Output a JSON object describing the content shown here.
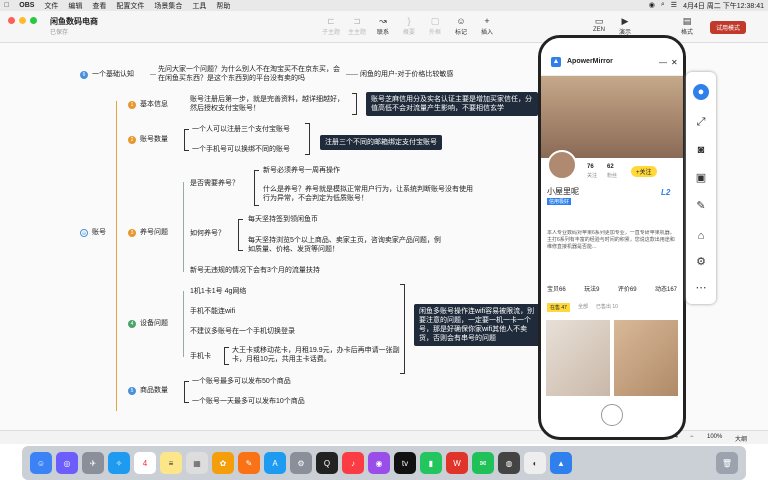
{
  "menubar": {
    "apple": "",
    "app": "OBS",
    "items": [
      "文件",
      "编辑",
      "查看",
      "配置文件",
      "场景集合",
      "工具",
      "帮助"
    ],
    "datetime": "4月4日 周二 下午12:38:41"
  },
  "window": {
    "title": "闲鱼数码电商",
    "subtitle": "已保存"
  },
  "toolbar": {
    "items": [
      {
        "label": "子主题",
        "icon": "⊏"
      },
      {
        "label": "主主题",
        "icon": "⊐"
      },
      {
        "label": "联系",
        "icon": "↝"
      },
      {
        "label": "概要",
        "icon": "}"
      },
      {
        "label": "外框",
        "icon": "▢"
      },
      {
        "label": "标记",
        "icon": "☺"
      },
      {
        "label": "插入",
        "icon": "+"
      }
    ],
    "zen": "ZEN",
    "present": "演示",
    "format": "格式",
    "trial": "试用模式"
  },
  "mindmap": {
    "topic1": {
      "num": "6",
      "label": "一个基础认知",
      "q": "先问大家一个问题？为什么别人不在淘宝买不在京东买，会在闲鱼买东西？是这个东西到的平台没有卖的吗",
      "a": "闲鱼的用户-对于价格比较敏感"
    },
    "root": {
      "label": "账号"
    },
    "b1": {
      "num": "1",
      "label": "基本信息",
      "text": "账号注册后第一步，就是完善资料，越详细越好，然后授权支付宝账号！",
      "note": "账号芝麻信用分及实名认证主要是增加买家信任，分值高低不会对流量产生影响，不要相信玄学"
    },
    "b2": {
      "num": "2",
      "label": "账号数量",
      "items": [
        "一个人可以注册三个支付宝账号",
        "一个手机号可以换绑不同的账号"
      ],
      "note": "注册三个不同的邮箱绑定支付宝账号"
    },
    "b3": {
      "num": "3",
      "label": "养号问题",
      "q1": "是否需要养号？",
      "a1": "新号必须养号一周再操作",
      "a2": "什么是养号？养号就是模拟正常用户行为，让系统判断账号没有使用行为异常，不会判定为低质账号！",
      "q2": "如何养号？",
      "a3": "每天坚持签到领闲鱼币",
      "a4": "每天坚持浏览5个以上商品、卖家主页，咨询卖家产品问题，例如质量、价格、发货等问题！",
      "a5": "新号无违规的情况下会有3个月的流量扶持"
    },
    "b4": {
      "num": "4",
      "label": "设备问题",
      "items": [
        "1机1卡1号 4g网络",
        "手机不能连wifi",
        "不建议多账号在一个手机切换登录"
      ],
      "phone": "手机卡",
      "phone_detail": "大王卡或移动花卡，月租19.9元，办卡后再申请一张副卡，月租10元，共用主卡话费。",
      "note": "闲鱼多账号操作连wifi容易被限流，别要注意的问题，一定要一机一卡一个号，那是好确保你家wifi其他人不卖货，否则会有串号的问题"
    },
    "b5": {
      "num": "5",
      "label": "商品数量",
      "items": [
        "一个账号最多可以发布50个商品",
        "一个账号一天最多可以发布10个商品"
      ]
    }
  },
  "status": {
    "zoom": "100%",
    "size": "大纲",
    "page": "174"
  },
  "phone": {
    "app": "ApowerMirror",
    "stats": [
      {
        "v": "76",
        "l": "关注"
      },
      {
        "v": "62",
        "l": "粉丝"
      }
    ],
    "follow": "+关注",
    "name": "小屋里呢",
    "tags": [
      "信用极好"
    ],
    "bio": "本人专业数码对苹果6系列更加专业，一直专研苹果机器。主打6系列有丰富的经验与时间的积累，您说这款出用途和维修直接机器是否能...",
    "tabs": [
      "宝贝66",
      "玩法9",
      "评价69",
      "动态167"
    ],
    "subtabs": [
      "在售 47",
      "全部",
      "已售出 10"
    ],
    "level": "L2"
  },
  "dock": {
    "apps": [
      "Finder",
      "Siri",
      "Launchpad",
      "Safari",
      "日历",
      "备忘录",
      "照片",
      "Pages",
      "App Store",
      "设置",
      "QQ",
      "音乐",
      "播客",
      "TV",
      "Numbers",
      "WPS",
      "微信",
      "Chrome",
      "OBS",
      "Safari",
      "ApowerMirror",
      "Trash"
    ]
  }
}
